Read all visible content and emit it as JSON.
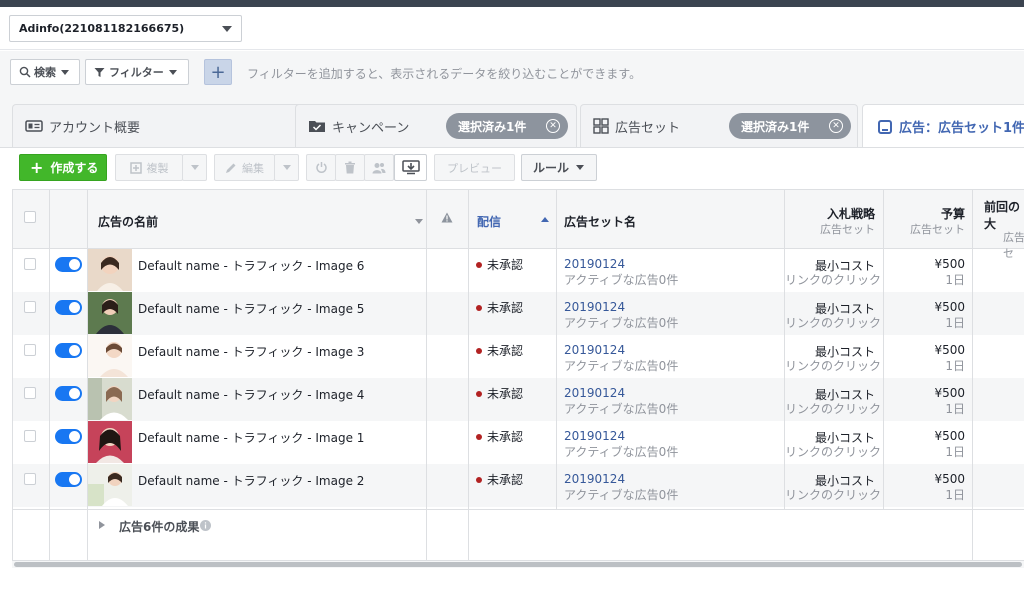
{
  "account": {
    "name": "Adinfo(221081182166675)"
  },
  "filterbar": {
    "search_label": "検索",
    "filter_label": "フィルター",
    "add_symbol": "+",
    "hint": "フィルターを追加すると、表示されるデータを絞り込むことができます。"
  },
  "tabs": {
    "account": "アカウント概要",
    "campaign": "キャンペーン",
    "campaign_chip": "選択済み1件",
    "adset": "広告セット",
    "adset_chip": "選択済み1件",
    "ads": "広告：広告セット1件"
  },
  "toolbar": {
    "create": "作成する",
    "duplicate": "複製",
    "edit": "編集",
    "preview": "プレビュー",
    "rules": "ルール"
  },
  "columns": {
    "name": "広告の名前",
    "delivery": "配信",
    "adset": "広告セット名",
    "bid": "入札戦略",
    "bid_sub": "広告セット",
    "budget": "予算",
    "budget_sub": "広告セット",
    "prev": "前回の大",
    "prev_sub": "広告セ"
  },
  "rows": [
    {
      "name": "Default name - トラフィック - Image 6",
      "status": "未承認",
      "adset": "20190124",
      "adset_sub": "アクティブな広告0件",
      "bid": "最小コスト",
      "bid_sub": "リンクのクリック",
      "budget": "¥500",
      "budget_sub": "1日"
    },
    {
      "name": "Default name - トラフィック - Image 5",
      "status": "未承認",
      "adset": "20190124",
      "adset_sub": "アクティブな広告0件",
      "bid": "最小コスト",
      "bid_sub": "リンクのクリック",
      "budget": "¥500",
      "budget_sub": "1日"
    },
    {
      "name": "Default name - トラフィック - Image 3",
      "status": "未承認",
      "adset": "20190124",
      "adset_sub": "アクティブな広告0件",
      "bid": "最小コスト",
      "bid_sub": "リンクのクリック",
      "budget": "¥500",
      "budget_sub": "1日"
    },
    {
      "name": "Default name - トラフィック - Image 4",
      "status": "未承認",
      "adset": "20190124",
      "adset_sub": "アクティブな広告0件",
      "bid": "最小コスト",
      "bid_sub": "リンクのクリック",
      "budget": "¥500",
      "budget_sub": "1日"
    },
    {
      "name": "Default name - トラフィック - Image 1",
      "status": "未承認",
      "adset": "20190124",
      "adset_sub": "アクティブな広告0件",
      "bid": "最小コスト",
      "bid_sub": "リンクのクリック",
      "budget": "¥500",
      "budget_sub": "1日"
    },
    {
      "name": "Default name - トラフィック - Image 2",
      "status": "未承認",
      "adset": "20190124",
      "adset_sub": "アクティブな広告0件",
      "bid": "最小コスト",
      "bid_sub": "リンクのクリック",
      "budget": "¥500",
      "budget_sub": "1日"
    }
  ],
  "summary": {
    "label": "広告6件の成果"
  },
  "colors": {
    "accent": "#4267b2",
    "create_green": "#42b72a",
    "toggle_blue": "#1877f2",
    "status_red": "#b22222"
  }
}
